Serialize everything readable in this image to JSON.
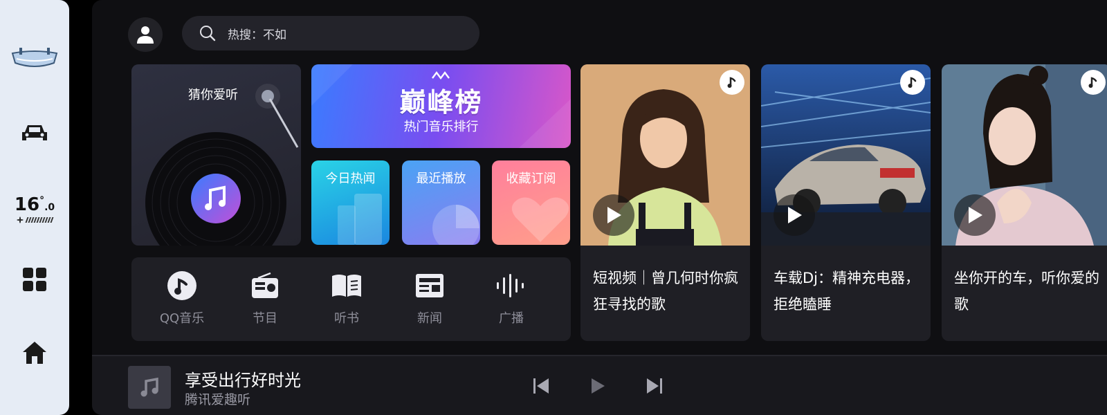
{
  "dock": {
    "temperature": "16",
    "temperature_decimal": ".0",
    "temperature_unit": "°",
    "icons": [
      "vehicle-top-icon",
      "car-icon",
      "fan-icon",
      "apps-grid-icon",
      "home-icon"
    ]
  },
  "header": {
    "search_text": "热搜：不如"
  },
  "guess": {
    "title": "猜你爱听"
  },
  "peak_chart": {
    "logo": "巅峰榜",
    "subtitle": "热门音乐排行"
  },
  "shortcuts": [
    {
      "label": "今日热闻"
    },
    {
      "label": "最近播放"
    },
    {
      "label": "收藏订阅"
    }
  ],
  "categories": [
    {
      "label": "QQ音乐",
      "icon": "qq-music-icon"
    },
    {
      "label": "节目",
      "icon": "radio-icon"
    },
    {
      "label": "听书",
      "icon": "book-icon"
    },
    {
      "label": "新闻",
      "icon": "news-icon"
    },
    {
      "label": "广播",
      "icon": "broadcast-icon"
    }
  ],
  "cards": [
    {
      "text": "短视频｜曾几何时你疯狂寻找的歌"
    },
    {
      "text": "车载Dj：精神充电器，拒绝瞌睡"
    },
    {
      "text": "坐你开的车，听你爱的歌"
    }
  ],
  "player": {
    "title": "享受出行好时光",
    "subtitle": "腾讯爱趣听"
  },
  "colors": {
    "accent_blue": "#3a7cff",
    "accent_purple": "#7a4df0",
    "panel_bg": "#0f0f12",
    "card_bg": "#1f1f25"
  }
}
